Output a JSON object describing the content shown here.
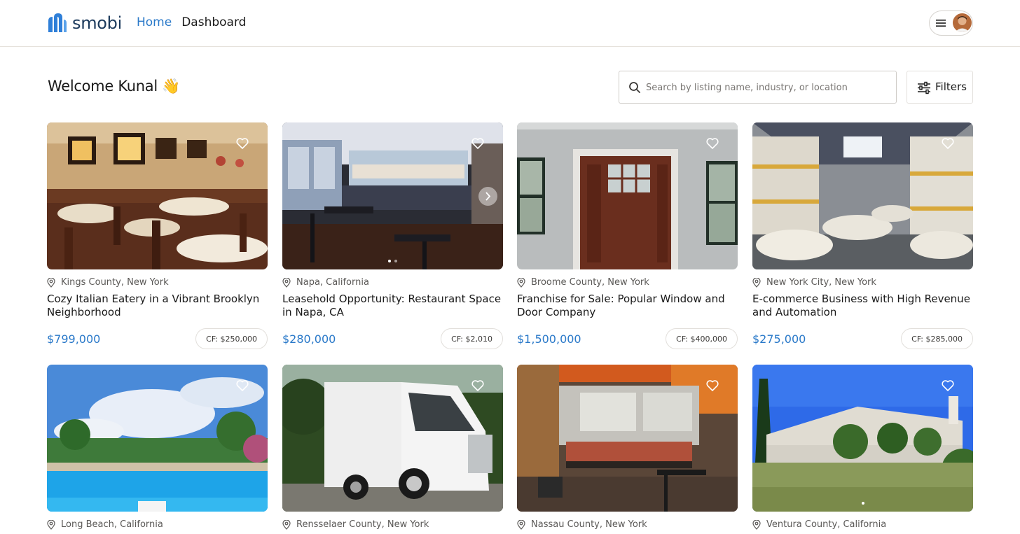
{
  "brand": {
    "name": "smobi"
  },
  "nav": {
    "items": [
      {
        "label": "Home",
        "active": true
      },
      {
        "label": "Dashboard",
        "active": false
      }
    ]
  },
  "header": {
    "menu_icon": "hamburger-icon",
    "avatar": "user-avatar"
  },
  "welcome": {
    "text": "Welcome Kunal 👋"
  },
  "search": {
    "placeholder": "Search by listing name, industry, or location",
    "icon": "search-icon"
  },
  "filters": {
    "label": "Filters",
    "icon": "sliders-icon"
  },
  "colors": {
    "accent": "#2a79c9",
    "brand": "#2f7fd8",
    "text": "#1a1a1a",
    "muted": "#5a5856"
  },
  "listings": [
    {
      "location": "Kings County, New York",
      "title": "Cozy Italian Eatery in a Vibrant Brooklyn Neighborhood",
      "price": "$799,000",
      "cf": "CF: $250,000",
      "image": "restaurant-dining-room"
    },
    {
      "location": "Napa, California",
      "title": "Leasehold Opportunity: Restaurant Space in Napa, CA",
      "price": "$280,000",
      "cf": "CF: $2,010",
      "image": "restaurant-bar-counter"
    },
    {
      "location": "Broome County, New York",
      "title": "Franchise for Sale: Popular Window and Door Company",
      "price": "$1,500,000",
      "cf": "CF: $400,000",
      "image": "wooden-front-door"
    },
    {
      "location": "New York City, New York",
      "title": "E-commerce Business with High Revenue and Automation",
      "price": "$275,000",
      "cf": "CF: $285,000",
      "image": "warehouse-pallets"
    },
    {
      "location": "Long Beach, California",
      "image": "resort-swimming-pool"
    },
    {
      "location": "Rensselaer County, New York",
      "image": "white-semi-truck"
    },
    {
      "location": "Nassau County, New York",
      "image": "diner-booths"
    },
    {
      "location": "Ventura County, California",
      "image": "suburban-house"
    }
  ]
}
